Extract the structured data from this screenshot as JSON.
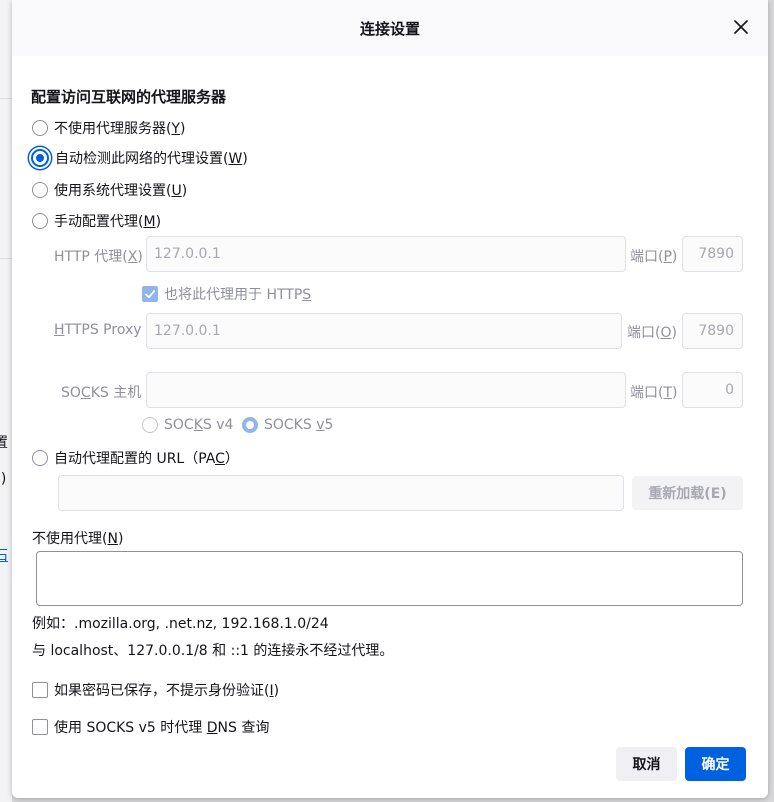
{
  "dialog": {
    "title": "连接设置",
    "heading": "配置访问互联网的代理服务器"
  },
  "behind_fragments": [
    "置",
    "j)",
    "石"
  ],
  "options": {
    "no_proxy": {
      "text": "不使用代理服务器(",
      "key": "Y",
      "end": ")"
    },
    "auto_detect": {
      "text": "自动检测此网络的代理设置(",
      "key": "W",
      "end": ")"
    },
    "system_proxy": {
      "text": "使用系统代理设置(",
      "key": "U",
      "end": ")"
    },
    "manual_proxy": {
      "text": "手动配置代理(",
      "key": "M",
      "end": ")"
    },
    "pac": {
      "text": "自动代理配置的 URL（PA",
      "key": "C",
      "end": "）"
    }
  },
  "manual": {
    "http_label": {
      "text": "HTTP 代理(",
      "key": "X",
      "end": ")"
    },
    "http_value": "127.0.0.1",
    "http_port_label": {
      "text": "端口(",
      "key": "P",
      "end": ")"
    },
    "http_port": "7890",
    "also_https": {
      "text": "也将此代理用于 HTTP",
      "key": "S",
      "end": ""
    },
    "https_label": {
      "pre": "",
      "key": "H",
      "text": "TTPS Proxy"
    },
    "https_value": "127.0.0.1",
    "https_port_label": {
      "text": "端口(",
      "key": "O",
      "end": ")"
    },
    "https_port": "7890",
    "socks_label": {
      "pre": "SO",
      "key": "C",
      "text": "KS 主机"
    },
    "socks_value": "",
    "socks_port_label": {
      "text": "端口(",
      "key": "T",
      "end": ")"
    },
    "socks_port": "0",
    "socks_v4": {
      "pre": "SOC",
      "key": "K",
      "text": "S v4"
    },
    "socks_v5": {
      "pre": "SOCKS ",
      "key": "v",
      "text": "5"
    }
  },
  "pac": {
    "url": "",
    "reload_label": "重新加载(E)"
  },
  "no_proxy_for": {
    "label": {
      "text": "不使用代理(",
      "key": "N",
      "end": ")"
    },
    "value": "",
    "example": "例如：.mozilla.org, .net.nz, 192.168.1.0/24",
    "note": "与 localhost、127.0.0.1/8 和 ::1 的连接永不经过代理。"
  },
  "checkboxes": {
    "no_auth_prompt": {
      "text": "如果密码已保存，不提示身份验证(",
      "key": "I",
      "end": ")"
    },
    "socks_dns": {
      "text": "使用 SOCKS v5 时代理 ",
      "key": "D",
      "end": "NS 查询"
    }
  },
  "buttons": {
    "cancel": "取消",
    "ok": "确定"
  },
  "colors": {
    "accent": "#0061e0",
    "disabled_accent": "#8fb5ec",
    "secondary_button": "#f0f0f4"
  }
}
